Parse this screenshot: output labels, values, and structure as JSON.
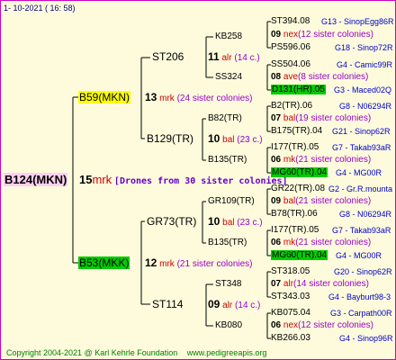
{
  "header": {
    "date": "1-  10-2021  ( 16:  58)"
  },
  "footer": {
    "copyright": "Copyright 2004-2021 @ Karl Kehrle Foundation",
    "url": "www.pedigreeapis.org"
  },
  "root": {
    "label": "B124(MKN)",
    "num": "15",
    "code": "mrk",
    "note": "[Drones from 30 sister colonies]"
  },
  "gen1": {
    "upper": {
      "label": "B59(MKN)",
      "num": "13",
      "code": "mrk",
      "note": "(24 sister colonies)"
    },
    "lower": {
      "label": "B53(MKK)",
      "num": "12",
      "code": "mrk",
      "note": "(21 sister colonies)"
    }
  },
  "gen2": {
    "a": {
      "label": "ST206",
      "num": "11",
      "code": "alr",
      "note": "(14 c.)"
    },
    "b": {
      "label": "B129(TR)",
      "num": "10",
      "code": "bal",
      "note": "(23 c.)"
    },
    "c": {
      "label": "GR73(TR)",
      "num": "10",
      "code": "bal",
      "note": "(23 c.)"
    },
    "d": {
      "label": "ST114",
      "num": "09",
      "code": "alr",
      "note": "(14 c.)"
    }
  },
  "gen3": {
    "a1": {
      "label": "KB258",
      "num": "09",
      "code": "nex",
      "note": "(12 sister colonies)"
    },
    "a2": {
      "label": "SS324",
      "num": "08",
      "code": "ave",
      "note": "(8 sister colonies)"
    },
    "b1": {
      "label": "B82(TR)",
      "num": "07",
      "code": "bal",
      "note": "(19 sister colonies)"
    },
    "b2": {
      "label": "B135(TR)",
      "num": "06",
      "code": "mk",
      "note": "(21 sister colonies)"
    },
    "c1": {
      "label": "GR109(TR)",
      "num": "09",
      "code": "bal",
      "note": "(21 sister colonies)"
    },
    "c2": {
      "label": "B135(TR)",
      "num": "06",
      "code": "mk",
      "note": "(21 sister colonies)"
    },
    "d1": {
      "label": "ST348",
      "num": "07",
      "code": "alr",
      "note": "(14 sister colonies)"
    },
    "d2": {
      "label": "KB080",
      "num": "06",
      "code": "nex",
      "note": "(12 sister colonies)"
    }
  },
  "gen4": {
    "a1q": {
      "label": "ST394.08",
      "info": "G13 - SinopEgg86R"
    },
    "a1d": {
      "label": "PS596.06",
      "info": "G18 - Sinop72R"
    },
    "a2q": {
      "label": "SS504.06",
      "info": "G4 - Camic99R"
    },
    "a2d": {
      "label": "D131(HR).05",
      "info": "G3 - Maced02Q"
    },
    "b1q": {
      "label": "B2(TR).06",
      "info": "G8 - N06294R"
    },
    "b1d": {
      "label": "B175(TR).04",
      "info": "G21 - Sinop62R"
    },
    "b2q": {
      "label": "I177(TR).05",
      "info": "G7 - Takab93aR"
    },
    "b2d": {
      "label": "MG60(TR).04",
      "info": "G4 - MG00R"
    },
    "c1q": {
      "label": "GR22(TR).08",
      "info": "G2 - Gr.R.mounta"
    },
    "c1d": {
      "label": "B78(TR).06",
      "info": "G8 - N06294R"
    },
    "c2q": {
      "label": "I177(TR).05",
      "info": "G7 - Takab93aR"
    },
    "c2d": {
      "label": "MG60(TR).04",
      "info": "G4 - MG00R"
    },
    "d1q": {
      "label": "ST318.05",
      "info": "G20 - Sinop62R"
    },
    "d1d": {
      "label": "ST343.03",
      "info": "G4 - Bayburt98-3"
    },
    "d2q": {
      "label": "KB075.04",
      "info": "G3 - Carpath00R"
    },
    "d2d": {
      "label": "KB266.03",
      "info": "G4 - Sinop96R"
    }
  }
}
